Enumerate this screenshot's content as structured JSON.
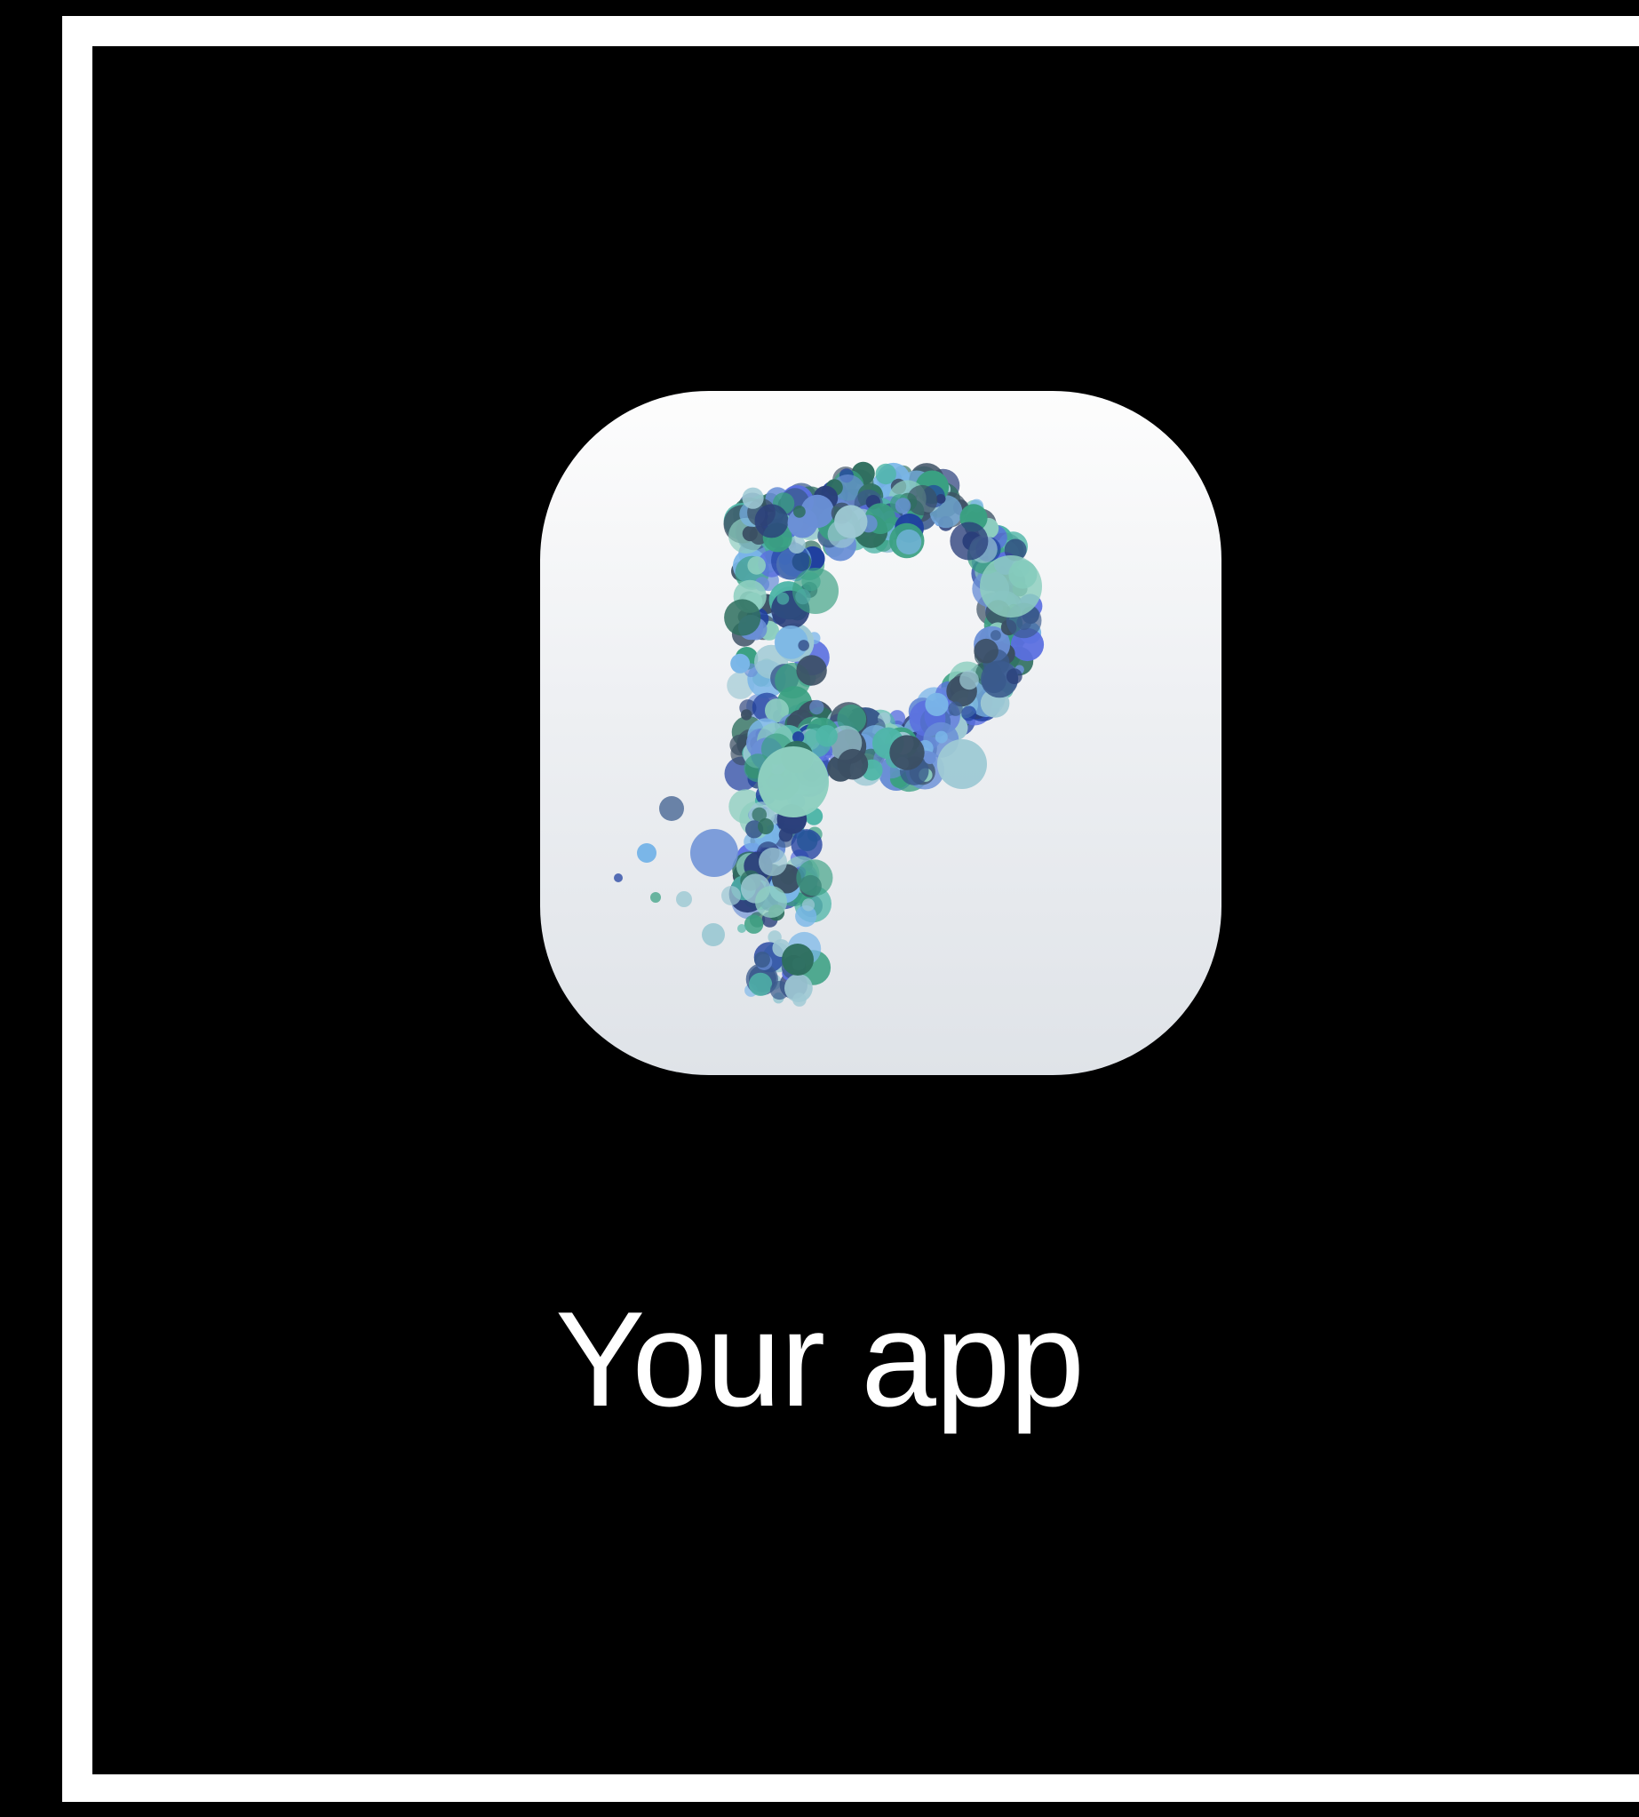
{
  "app": {
    "label": "Your app",
    "icon_name": "p-bubbles-logo-icon"
  },
  "colors": {
    "background": "#000000",
    "border": "#ffffff",
    "label_text": "#ffffff",
    "icon_bg_top": "#fdfdfd",
    "icon_bg_bottom": "#dfe3e8",
    "bubble_palette": [
      "#2e6e5e",
      "#3a5a8c",
      "#4fb6a8",
      "#6a8fd6",
      "#2a3f7a",
      "#9ec9d4",
      "#3b4f63",
      "#5a6fe0",
      "#3aa082",
      "#7ab6e8",
      "#1f3f9f",
      "#8ecfc0"
    ]
  }
}
